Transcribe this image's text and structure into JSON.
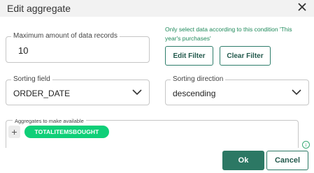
{
  "dialog": {
    "title": "Edit aggregate"
  },
  "max_records": {
    "label": "Maximum amount of data records",
    "value": "10"
  },
  "condition_text": "Only select data according to this condition 'This year's purchases'",
  "filter_buttons": {
    "edit": "Edit Filter",
    "clear": "Clear Filter"
  },
  "sorting_field": {
    "label": "Sorting field",
    "value": "ORDER_DATE"
  },
  "sorting_direction": {
    "label": "Sorting direction",
    "value": "descending"
  },
  "aggregates": {
    "label": "Aggregates to make available",
    "items": [
      "TOTALITEMSBOUGHT"
    ]
  },
  "footer": {
    "ok": "Ok",
    "cancel": "Cancel"
  },
  "icons": {
    "close": "close-icon",
    "chevron": "chevron-down-icon",
    "add": "plus-icon",
    "info": "info-icon"
  },
  "colors": {
    "primary": "#2c7864",
    "chip": "#0fcf78",
    "condition_text": "#1f8a5b"
  }
}
